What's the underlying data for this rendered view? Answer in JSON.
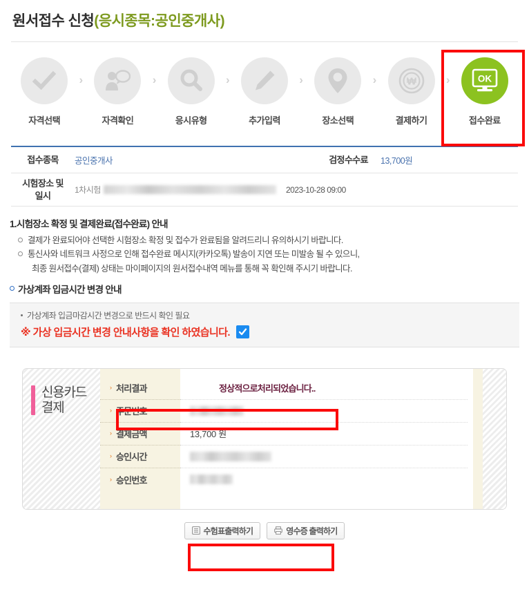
{
  "header": {
    "title_main": "원서접수 신청",
    "title_subject": "(응시종목:공인중개사)"
  },
  "steps": [
    {
      "label": "자격선택",
      "icon": "check-icon",
      "state": "done"
    },
    {
      "label": "자격확인",
      "icon": "person-speech-icon",
      "state": "done"
    },
    {
      "label": "응시유형",
      "icon": "magnifier-icon",
      "state": "done"
    },
    {
      "label": "추가입력",
      "icon": "pencil-icon",
      "state": "done"
    },
    {
      "label": "장소선택",
      "icon": "map-pin-icon",
      "state": "done"
    },
    {
      "label": "결제하기",
      "icon": "won-coin-icon",
      "state": "done"
    },
    {
      "label": "접수완료",
      "icon": "monitor-ok-icon",
      "state": "active"
    }
  ],
  "step_separator": "›",
  "info_table": {
    "subject_label": "접수종목",
    "subject_value": "공인중개사",
    "fee_label": "검정수수료",
    "fee_value": "13,700원",
    "place_label_line1": "시험장소 및",
    "place_label_line2": "일시",
    "place_value_prefix": "1차시험",
    "place_value_masked": true,
    "datetime_value": "2023-10-28 09:00"
  },
  "notices": {
    "heading": "1.시험장소 확정 및 결제완료(접수완료) 안내",
    "items": [
      "결제가 완료되어야 선택한 시험장소 확정 및 접수가 완료됨을 알려드리니 유의하시기 바랍니다.",
      "통신사와 네트워크 사정으로 인해 접수완료 메시지(카카오톡) 발송이 지연 또는 미발송 될 수 있으니,"
    ],
    "continuation": "최종 원서접수(결제) 상태는 마이페이지의 원서접수내역 메뉴를 통해 꼭 확인해 주시기 바랍니다.",
    "heading2": "가상계좌 입금시간 변경 안내"
  },
  "confirm_box": {
    "sub_text": "가상계좌 입금마감시간 변경으로 반드시 확인 필요",
    "main_text": "※ 가상 입금시간 변경 안내사항을 확인 하였습니다.",
    "checked": true
  },
  "payment": {
    "panel_title_line1": "신용카드",
    "panel_title_line2": "결제",
    "rows": [
      {
        "key": "처리결과",
        "value": "정상적으로처리되었습니다..",
        "masked": false,
        "highlight": true
      },
      {
        "key": "주문번호",
        "value": "",
        "masked": true,
        "mask_width": 78,
        "highlight": false
      },
      {
        "key": "결제금액",
        "value": "13,700 원",
        "masked": false,
        "highlight": false
      },
      {
        "key": "승인시간",
        "value": "",
        "masked": true,
        "mask_width": 118,
        "highlight": false
      },
      {
        "key": "승인번호",
        "value": "",
        "masked": true,
        "mask_width": 62,
        "highlight": false
      }
    ],
    "row_arrow": "›"
  },
  "buttons": [
    {
      "label": "수험표출력하기",
      "icon": "list-document-icon"
    },
    {
      "label": "영수증 출력하기",
      "icon": "printer-icon"
    }
  ],
  "colors": {
    "accent_green": "#8cc220",
    "title_subject": "#7d9a1f",
    "table_top_border": "#3f72b0",
    "link_blue": "#4a73ae",
    "warning_red": "#ea3323",
    "annotation_red": "#fb0a0a",
    "checkbox_blue": "#1a8bf0",
    "pay_accent_pink": "#f0609a",
    "result_maroon": "#6b2040"
  }
}
